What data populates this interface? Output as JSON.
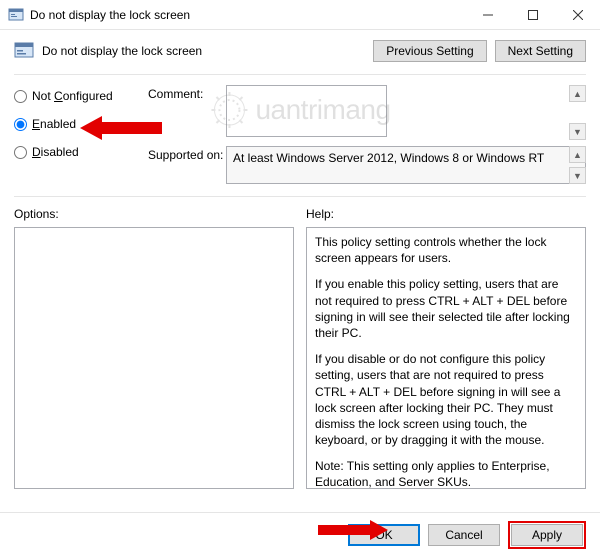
{
  "window": {
    "title": "Do not display the lock screen",
    "header": "Do not display the lock screen"
  },
  "nav": {
    "prev": "Previous Setting",
    "next": "Next Setting"
  },
  "radio": {
    "not_configured_prefix": "Not ",
    "not_configured_ul": "C",
    "not_configured_suffix": "onfigured",
    "enabled_ul": "E",
    "enabled_suffix": "nabled",
    "disabled_ul": "D",
    "disabled_suffix": "isabled"
  },
  "labels": {
    "comment": "Comment:",
    "supported": "Supported on:",
    "options": "Options:",
    "help": "Help:"
  },
  "supported_text": "At least Windows Server 2012, Windows 8 or Windows RT",
  "help": {
    "p1": "This policy setting controls whether the lock screen appears for users.",
    "p2": "If you enable this policy setting, users that are not required to press CTRL + ALT + DEL before signing in will see their selected tile after locking their PC.",
    "p3": "If you disable or do not configure this policy setting, users that are not required to press CTRL + ALT + DEL before signing in will see a lock screen after locking their PC. They must dismiss the lock screen using touch, the keyboard, or by dragging it with the mouse.",
    "p4": "Note: This setting only applies to Enterprise, Education, and Server SKUs."
  },
  "footer": {
    "ok": "OK",
    "cancel": "Cancel",
    "apply": "Apply"
  },
  "watermark": "uantrimang"
}
